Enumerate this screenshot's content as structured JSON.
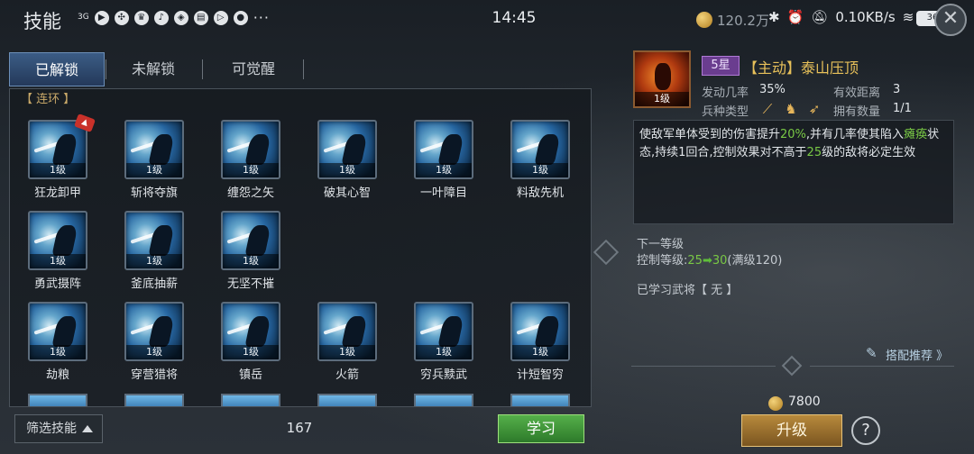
{
  "status_bar": {
    "title": "技能",
    "network": "3G",
    "time": "14:45",
    "coins": "120.2万",
    "speed": "0.10KB/s",
    "battery": "36"
  },
  "tabs": [
    {
      "label": "已解锁",
      "active": true
    },
    {
      "label": "未解锁",
      "active": false
    },
    {
      "label": "可觉醒",
      "active": false
    }
  ],
  "skill_panel": {
    "category": "【 连环 】",
    "level_label": "1级",
    "skills": [
      {
        "name": "狂龙卸甲",
        "level": "1级",
        "new": true
      },
      {
        "name": "斩将夺旗",
        "level": "1级"
      },
      {
        "name": "缠怨之矢",
        "level": "1级"
      },
      {
        "name": "破其心智",
        "level": "1级"
      },
      {
        "name": "一叶障目",
        "level": "1级"
      },
      {
        "name": "料敌先机",
        "level": "1级"
      },
      {
        "name": "勇武摄阵",
        "level": "1级"
      },
      {
        "name": "釜底抽薪",
        "level": "1级"
      },
      {
        "name": "无坚不摧",
        "level": "1级"
      },
      {
        "name": "劫粮",
        "level": "1级"
      },
      {
        "name": "穿营猎将",
        "level": "1级"
      },
      {
        "name": "镇岳",
        "level": "1级"
      },
      {
        "name": "火箭",
        "level": "1级"
      },
      {
        "name": "穷兵黩武",
        "level": "1级"
      },
      {
        "name": "计短智穷",
        "level": "1级"
      }
    ],
    "filter_label": "筛选技能",
    "count": "167",
    "learn_label": "学习"
  },
  "detail": {
    "portrait_level": "1级",
    "star": "5星",
    "title": "【主动】泰山压顶",
    "trigger_rate_label": "发动几率",
    "trigger_rate": "35%",
    "range_label": "有效距离",
    "range": "3",
    "troop_label": "兵种类型",
    "owned_label": "拥有数量",
    "owned": "1/1",
    "desc": {
      "p1": "使敌军单体受到的伤害提升",
      "v1": "20%",
      "p2": ",并有几率使其陷入",
      "v2": "瘫痪",
      "p3": "状态,持续1回合,控制效果对不高于",
      "v3": "25",
      "p4": "级的敌将必定生效"
    },
    "next_level_label": "下一等级",
    "control_label": "控制等级:",
    "control_from": "25",
    "control_to": "30",
    "control_max": "(满级120)",
    "learned_label": "已学习武将【 无 】",
    "recommend_label": "搭配推荐 》",
    "price": "7800",
    "upgrade_label": "升级",
    "help_label": "?"
  },
  "colors": {
    "accent_gold": "#e8c15a",
    "highlight_green": "#79c845",
    "highlight_yellow": "#d5c04a",
    "learn_green": "#55b04a"
  }
}
